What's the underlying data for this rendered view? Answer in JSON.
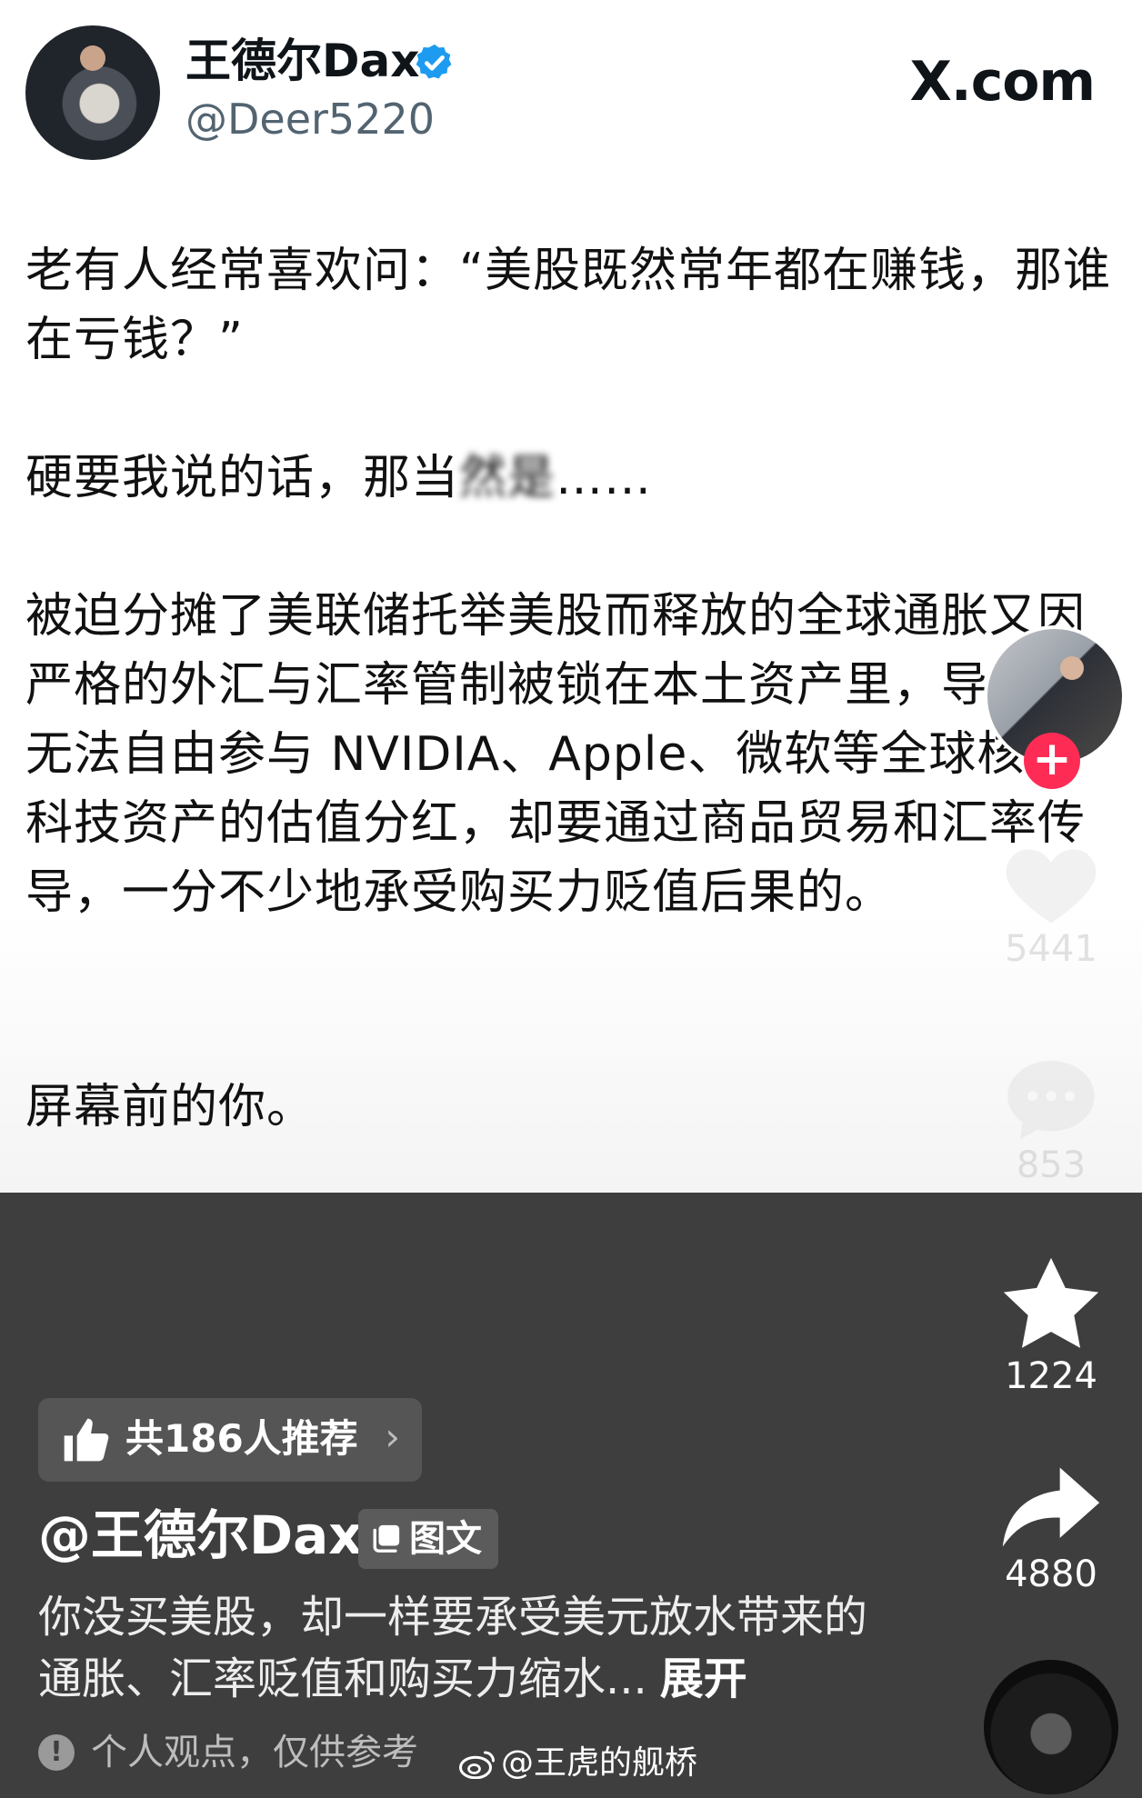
{
  "post": {
    "name": "王德尔Dax",
    "handle": "@Deer5220",
    "site": "X.com",
    "paragraphs": [
      "老有人经常喜欢问：“美股既然常年都在赚钱，那谁在亏钱？”",
      "硬要我说的话，那当然是……",
      "被迫分摊了美联储托举美股而释放的全球通胀又因严格的外汇与汇率管制被锁在本土资产里，导致既无法自由参与 NVIDIA、Apple、微软等全球核心科技资产的估值分红，却要通过商品贸易和汇率传导，一分不少地承受购买力贬值后果的。",
      "屏幕前的你。"
    ],
    "p2_visible": "硬要我说的话，那当",
    "p2_blurred": "然是",
    "p2_tail": "……"
  },
  "sidebar": {
    "likes": "5441",
    "comments": "853",
    "favorites": "1224",
    "shares": "4880"
  },
  "bottom": {
    "recommend_label": "共186人推荐",
    "author": "@王德尔Dax",
    "type_badge": "图文",
    "description": "你没买美股，却一样要承受美元放水带来的通胀、汇率贬值和购买力缩水...",
    "expand_label": "展开",
    "disclaimer": "个人观点，仅供参考",
    "watermark": "@王虎的舰桥"
  },
  "icons": {
    "verified": "verified-badge-icon",
    "follow": "plus-icon",
    "like": "heart-icon",
    "comment": "comment-bubble-icon",
    "favorite": "star-icon",
    "share": "share-arrow-icon",
    "recommend": "thumbs-up-icon",
    "type": "gallery-icon",
    "info": "info-icon",
    "weibo": "weibo-logo-icon"
  },
  "colors": {
    "follow_button": "#fe2c55",
    "verified_badge": "#1d9bf0",
    "panel_background": "#3e3e3e"
  }
}
